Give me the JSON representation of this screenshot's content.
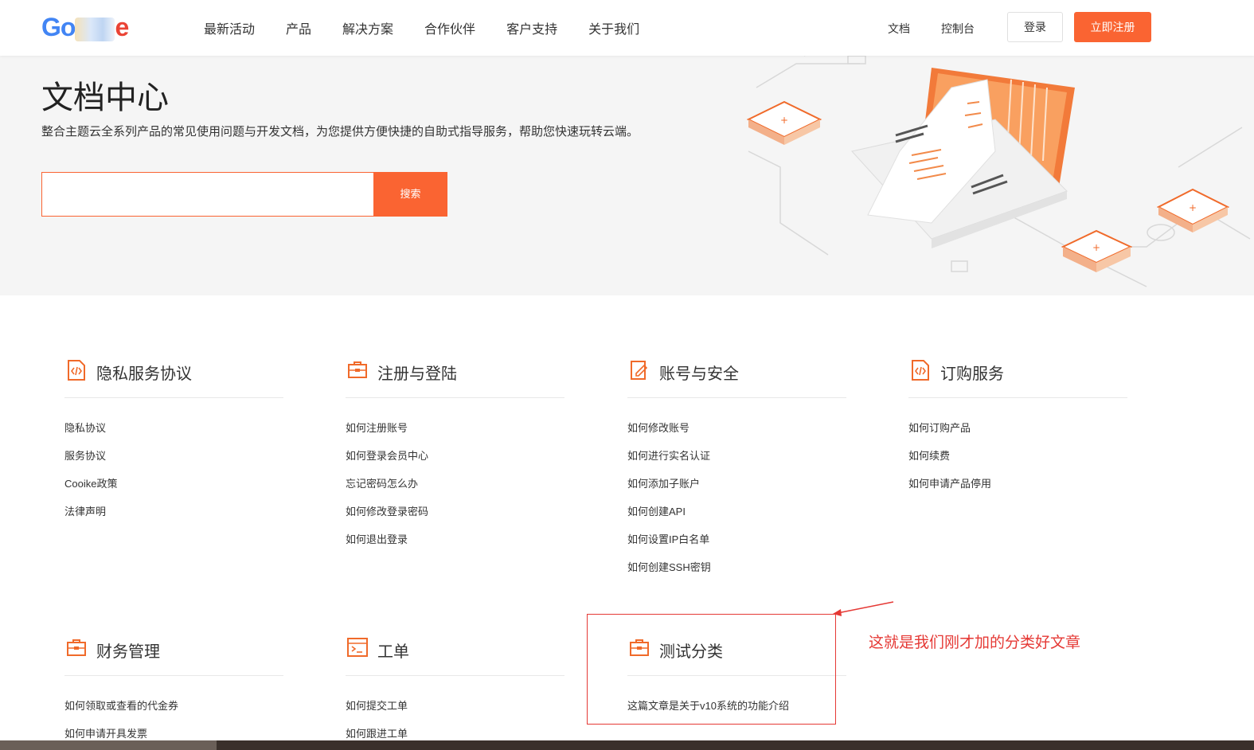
{
  "logo": {
    "visible_start": "Go",
    "visible_end": "e"
  },
  "nav": [
    "最新活动",
    "产品",
    "解决方案",
    "合作伙伴",
    "客户支持",
    "关于我们"
  ],
  "header_right": {
    "docs": "文档",
    "console": "控制台",
    "login": "登录",
    "register": "立即注册"
  },
  "hero": {
    "title": "文档中心",
    "subtitle": "整合主题云全系列产品的常见使用问题与开发文档，为您提供方便快捷的自助式指导服务，帮助您快速玩转云端。",
    "search_button": "搜索",
    "search_value": ""
  },
  "categories": [
    {
      "title": "隐私服务协议",
      "icon": "code-doc-icon",
      "items": [
        "隐私协议",
        "服务协议",
        "Cooike政策",
        "法律声明"
      ]
    },
    {
      "title": "注册与登陆",
      "icon": "briefcase-icon",
      "items": [
        "如何注册账号",
        "如何登录会员中心",
        "忘记密码怎么办",
        "如何修改登录密码",
        "如何退出登录"
      ]
    },
    {
      "title": "账号与安全",
      "icon": "edit-doc-icon",
      "items": [
        "如何修改账号",
        "如何进行实名认证",
        "如何添加子账户",
        "如何创建API",
        "如何设置IP白名单",
        "如何创建SSH密钥"
      ]
    },
    {
      "title": "订购服务",
      "icon": "code-doc-icon",
      "items": [
        "如何订购产品",
        "如何续费",
        "如何申请产品停用"
      ]
    },
    {
      "title": "财务管理",
      "icon": "briefcase-icon",
      "items": [
        "如何领取或查看的代金券",
        "如何申请开具发票"
      ]
    },
    {
      "title": "工单",
      "icon": "terminal-icon",
      "items": [
        "如何提交工单",
        "如何跟进工单"
      ]
    },
    {
      "title": "测试分类",
      "icon": "briefcase-icon",
      "items": [
        "这篇文章是关于v10系统的功能介绍"
      ]
    }
  ],
  "annotation": "这就是我们刚才加的分类好文章",
  "colors": {
    "accent": "#fa6432",
    "annotation": "#e53935"
  }
}
